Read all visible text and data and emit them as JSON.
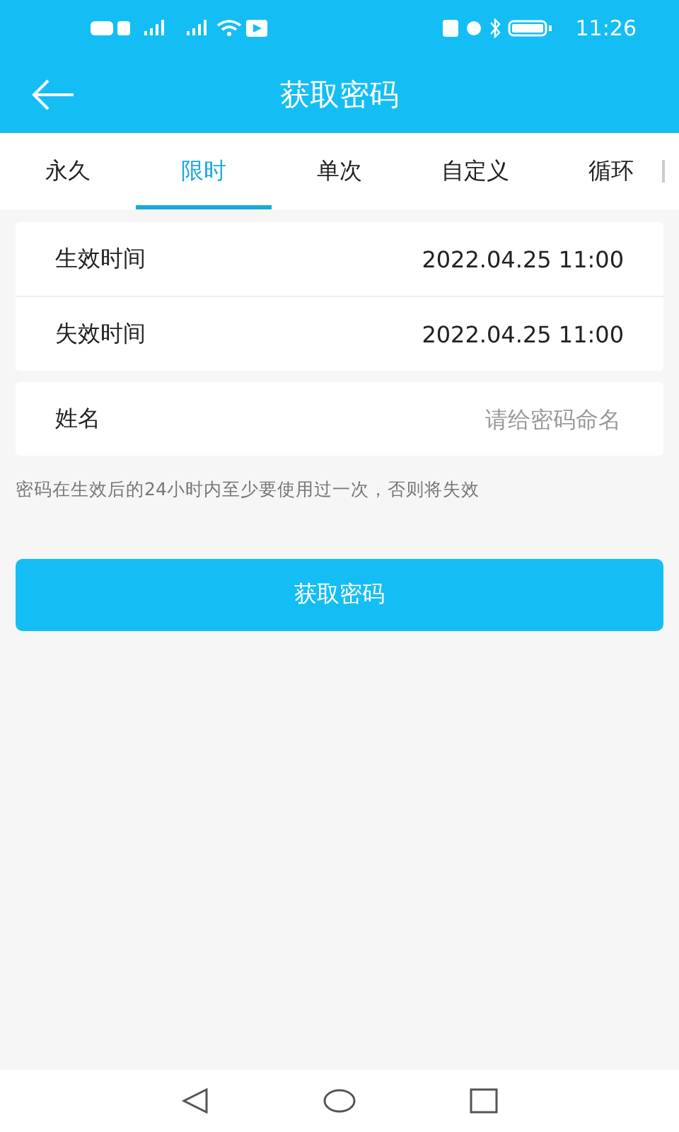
{
  "status_bar": {
    "time": "11:26"
  },
  "header": {
    "title": "获取密码"
  },
  "tabs": [
    {
      "label": "永久",
      "selected": false
    },
    {
      "label": "限时",
      "selected": true
    },
    {
      "label": "单次",
      "selected": false
    },
    {
      "label": "自定义",
      "selected": false
    },
    {
      "label": "循环",
      "selected": false
    }
  ],
  "time_rows": [
    {
      "label": "生效时间",
      "value": "2022.04.25 11:00"
    },
    {
      "label": "失效时间",
      "value": "2022.04.25 11:00"
    }
  ],
  "name_field": {
    "label": "姓名",
    "placeholder": "请给密码命名"
  },
  "hint": "密码在生效后的24小时内至少要使用过一次，否则将失效",
  "submit_button": "获取密码"
}
